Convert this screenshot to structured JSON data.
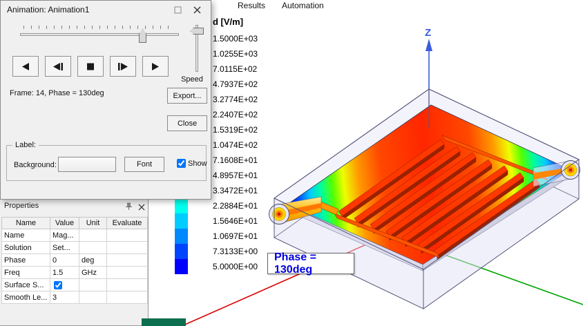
{
  "menubar": {
    "items": [
      "Results",
      "Automation"
    ]
  },
  "viewport": {
    "z_axis_label": "Z",
    "phase_label": "Phase = 130deg"
  },
  "legend": {
    "title": "d [V/m]",
    "entries": [
      {
        "value": "1.5000E+03",
        "color": "#ff0000"
      },
      {
        "value": "1.0255E+03",
        "color": "#ff4400"
      },
      {
        "value": "7.0115E+02",
        "color": "#ff8800"
      },
      {
        "value": "4.7937E+02",
        "color": "#ffcc00"
      },
      {
        "value": "3.2774E+02",
        "color": "#eeff00"
      },
      {
        "value": "2.2407E+02",
        "color": "#aaff00"
      },
      {
        "value": "1.5319E+02",
        "color": "#66ff00"
      },
      {
        "value": "1.0474E+02",
        "color": "#22ff00"
      },
      {
        "value": "7.1608E+01",
        "color": "#00ff22"
      },
      {
        "value": "4.8957E+01",
        "color": "#00ff66"
      },
      {
        "value": "3.3472E+01",
        "color": "#00ffaa"
      },
      {
        "value": "2.2884E+01",
        "color": "#00ffee"
      },
      {
        "value": "1.5646E+01",
        "color": "#00ccff"
      },
      {
        "value": "1.0697E+01",
        "color": "#0088ff"
      },
      {
        "value": "7.3133E+00",
        "color": "#0044ff"
      },
      {
        "value": "5.0000E+00",
        "color": "#0000ff"
      }
    ]
  },
  "animation_dialog": {
    "title": "Animation: Animation1",
    "frame_info": "Frame: 14, Phase = 130deg",
    "speed_label": "Speed",
    "export_button": "Export...",
    "close_button": "Close",
    "label_group": {
      "title": "Label:",
      "background_label": "Background:",
      "font_button": "Font",
      "show_label": "Show",
      "show_checked": true
    },
    "playback_icons": [
      "play-reverse-icon",
      "step-reverse-icon",
      "stop-icon",
      "step-forward-icon",
      "play-forward-icon"
    ]
  },
  "properties_panel": {
    "title": "Properties",
    "columns": [
      "Name",
      "Value",
      "Unit",
      "Evaluate"
    ],
    "rows": [
      {
        "name": "Name",
        "value": "Mag...",
        "unit": "",
        "evaluate": ""
      },
      {
        "name": "Solution",
        "value": "Set...",
        "unit": "",
        "evaluate": ""
      },
      {
        "name": "Phase",
        "value": "0",
        "unit": "deg",
        "evaluate": ""
      },
      {
        "name": "Freq",
        "value": "1.5",
        "unit": "GHz",
        "evaluate": ""
      },
      {
        "name": "Surface S...",
        "value": "",
        "unit": "",
        "evaluate": "",
        "checked": true
      },
      {
        "name": "Smooth Le...",
        "value": "3",
        "unit": "",
        "evaluate": ""
      }
    ]
  },
  "colors": {
    "x_axis": "#dd0000",
    "y_axis": "#00a500",
    "z_axis": "#3b5bdd",
    "phase_text": "#0000dd"
  }
}
